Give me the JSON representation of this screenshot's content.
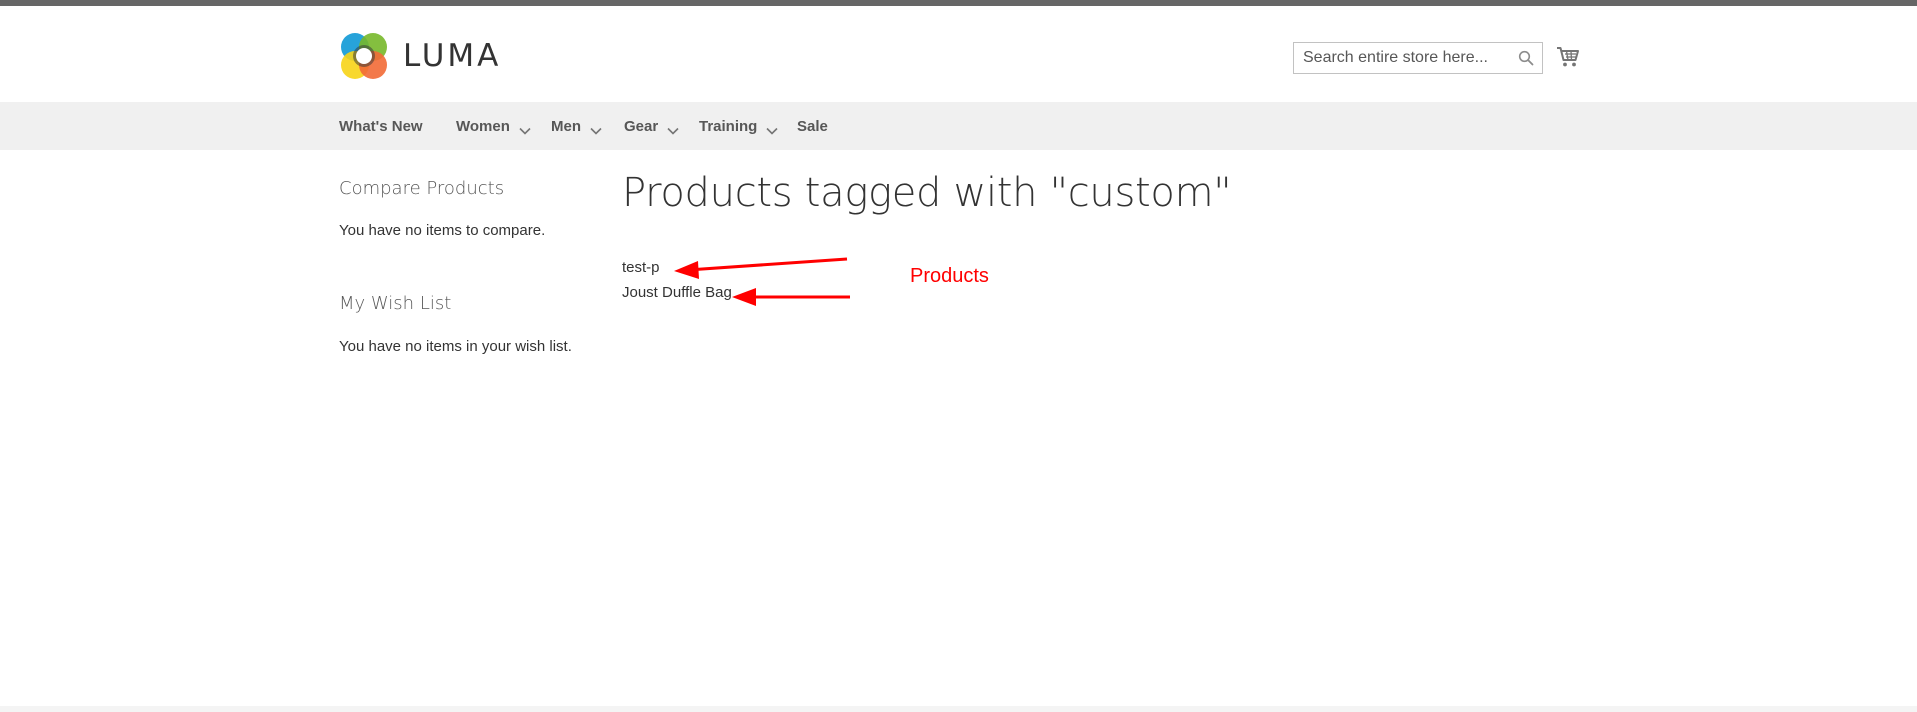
{
  "header": {
    "logo_text": "LUMA",
    "search_placeholder": "Search entire store here..."
  },
  "nav": {
    "items": [
      {
        "label": "What's New",
        "has_dropdown": false
      },
      {
        "label": "Women",
        "has_dropdown": true
      },
      {
        "label": "Men",
        "has_dropdown": true
      },
      {
        "label": "Gear",
        "has_dropdown": true
      },
      {
        "label": "Training",
        "has_dropdown": true
      },
      {
        "label": "Sale",
        "has_dropdown": false
      }
    ]
  },
  "sidebar": {
    "compare_title": "Compare Products",
    "compare_empty": "You have no items to compare.",
    "wishlist_title": "My Wish List",
    "wishlist_empty": "You have no items in your wish list."
  },
  "main": {
    "page_title": "Products tagged with \"custom\"",
    "products": [
      {
        "name": "test-p"
      },
      {
        "name": "Joust Duffle Bag"
      }
    ]
  },
  "annotation": {
    "label": "Products",
    "color": "#ff0000"
  },
  "icons": {
    "logo": "luma-logo-icon",
    "search": "search-icon",
    "cart": "cart-icon",
    "dropdown": "chevron-down-icon"
  },
  "colors": {
    "nav_background": "#f0f0f0",
    "top_strip": "#666666",
    "annotation": "#ff0000"
  }
}
